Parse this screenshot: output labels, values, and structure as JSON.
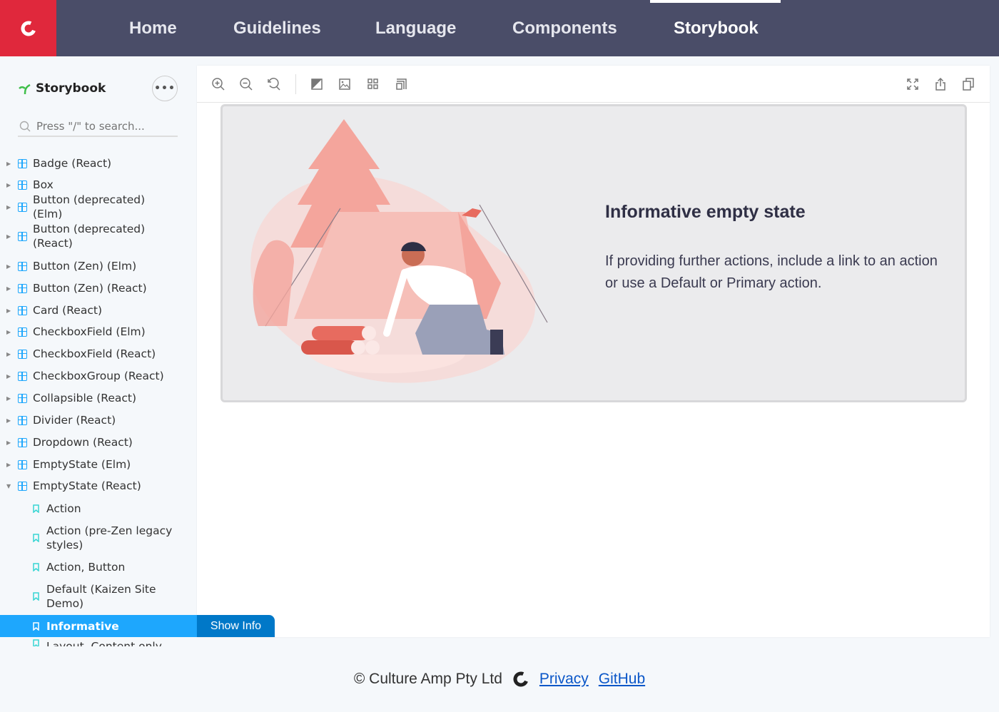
{
  "brand": {
    "logo": "culture-amp-logo",
    "color": "#e0283c"
  },
  "nav": [
    {
      "label": "Home"
    },
    {
      "label": "Guidelines"
    },
    {
      "label": "Language"
    },
    {
      "label": "Components"
    },
    {
      "label": "Storybook",
      "active": true
    }
  ],
  "sidebar": {
    "title": "Storybook",
    "more_icon": "ellipsis-icon",
    "search_placeholder": "Press \"/\" to search...",
    "components": [
      "Badge (React)",
      "Box",
      "Button (deprecated) (Elm)",
      "Button (deprecated) (React)",
      "Button (Zen) (Elm)",
      "Button (Zen) (React)",
      "Card (React)",
      "CheckboxField (Elm)",
      "CheckboxField (React)",
      "CheckboxGroup (React)",
      "Collapsible (React)",
      "Divider (React)",
      "Dropdown (React)",
      "EmptyState (Elm)",
      "EmptyState (React)"
    ],
    "expanded": "EmptyState (React)",
    "stories": [
      "Action",
      "Action (pre-Zen legacy styles)",
      "Action, Button",
      "Default (Kaizen Site Demo)",
      "Informative",
      "Layout, Content only"
    ],
    "selected": "Informative",
    "accent": "#1ea7fd"
  },
  "toolbar": {
    "left_icons": [
      "zoom-in-icon",
      "zoom-out-icon",
      "reset-zoom-icon",
      "background-icon",
      "image-icon",
      "grid-icon",
      "viewport-icon"
    ],
    "right_icons": [
      "fullscreen-icon",
      "share-icon",
      "copy-icon"
    ]
  },
  "preview": {
    "title": "Informative empty state",
    "body": "If providing further actions, include a link to an action or use a Default or Primary action."
  },
  "show_info": "Show Info",
  "footer": {
    "copyright": "© Culture Amp Pty Ltd",
    "links": [
      "Privacy",
      "GitHub"
    ]
  }
}
